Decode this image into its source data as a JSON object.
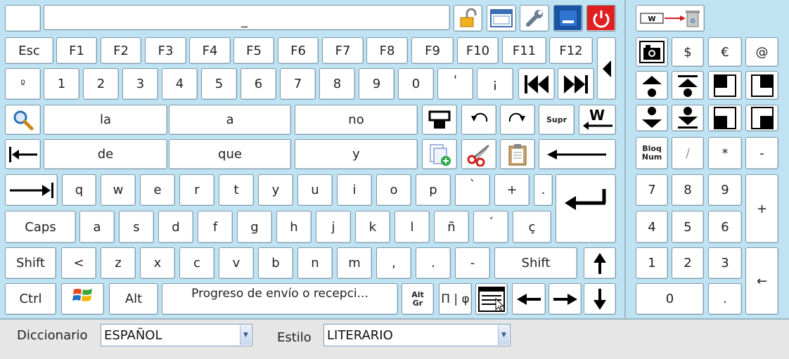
{
  "top": {
    "cursor_text": "_"
  },
  "fkeys": [
    "Esc",
    "F1",
    "F2",
    "F3",
    "F4",
    "F5",
    "F6",
    "F7",
    "F8",
    "F9",
    "F10",
    "F11",
    "F12"
  ],
  "numrow": [
    "º",
    "1",
    "2",
    "3",
    "4",
    "5",
    "6",
    "7",
    "8",
    "9",
    "0",
    "'",
    "¡"
  ],
  "predictions": [
    "la",
    "a",
    "no",
    "de",
    "que",
    "y"
  ],
  "text_keys": {
    "supr": "Supr",
    "bloq1": "Bloq",
    "bloq2": "Num",
    "altgr1": "Alt",
    "altgr2": "Gr",
    "pi_phi": "Π | φ"
  },
  "row_q": [
    "q",
    "w",
    "e",
    "r",
    "t",
    "y",
    "u",
    "i",
    "o",
    "p",
    "`",
    "+",
    "."
  ],
  "row_a": [
    "a",
    "s",
    "d",
    "f",
    "g",
    "h",
    "j",
    "k",
    "l",
    "ñ",
    "´",
    "ç"
  ],
  "row_z": [
    "<",
    "z",
    "x",
    "c",
    "v",
    "b",
    "n",
    "m",
    ",",
    ".",
    "-"
  ],
  "mods": {
    "tab": "",
    "caps": "Caps",
    "shift": "Shift",
    "ctrl": "Ctrl",
    "alt": "Alt"
  },
  "space_label": "Progreso de envío o recepci...",
  "side_symbols": [
    "$",
    "€",
    "@"
  ],
  "numpad": {
    "div": "/",
    "mul": "*",
    "sub": "-",
    "n7": "7",
    "n8": "8",
    "n9": "9",
    "add": "+",
    "n4": "4",
    "n5": "5",
    "n6": "6",
    "n1": "1",
    "n2": "2",
    "n3": "3",
    "n0": "0",
    "dot": ".",
    "enter_arrow": "←"
  },
  "bottom": {
    "dict_label": "Diccionario",
    "dict_value": "ESPAÑOL",
    "style_label": "Estilo",
    "style_value": "LITERARIO"
  },
  "colors": {
    "background": "#bfe3f2",
    "key": "#ffffff",
    "border": "#7c98a8",
    "power": "#e02020",
    "bottom_bar": "#e6e6e6"
  }
}
